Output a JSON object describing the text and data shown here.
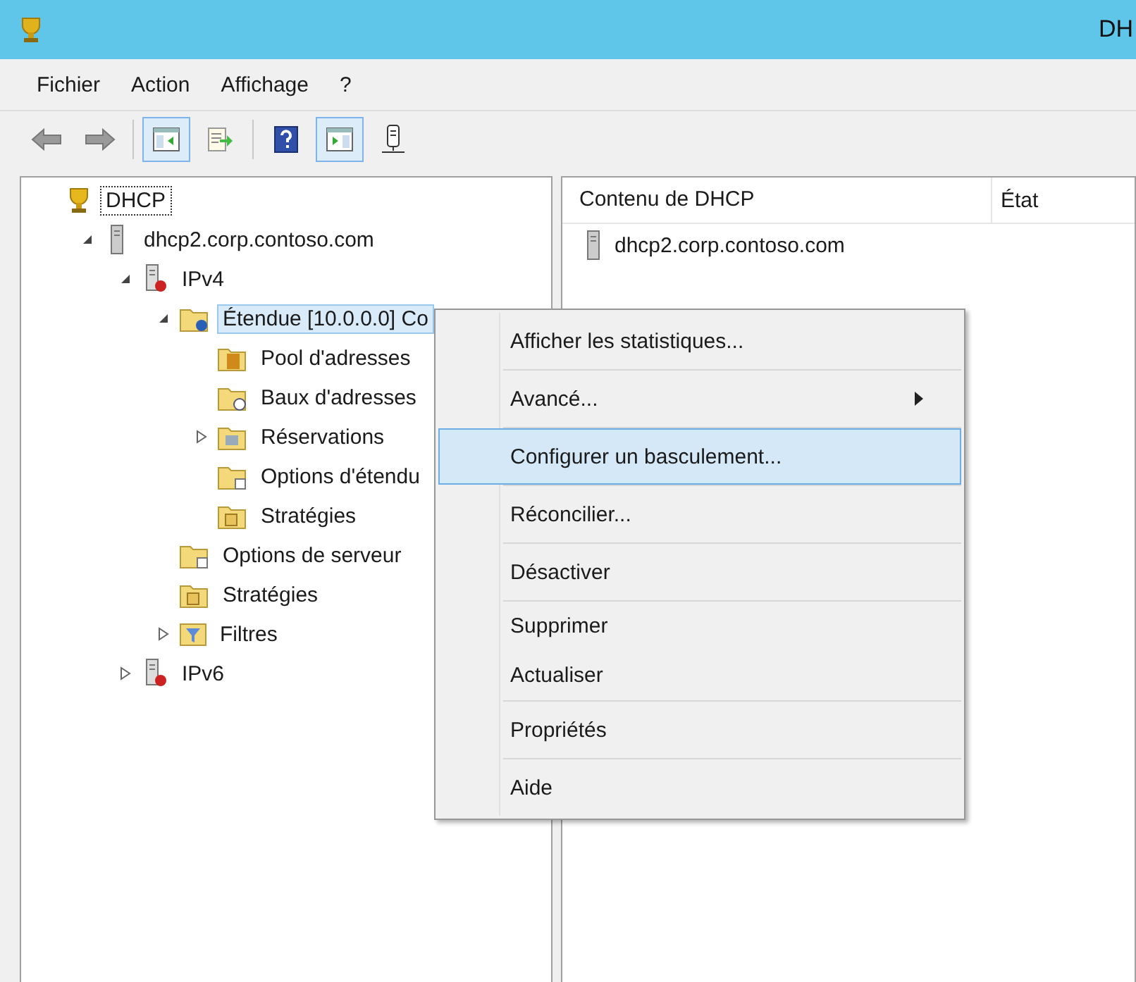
{
  "window": {
    "title": "DH"
  },
  "menu_bar": [
    "Fichier",
    "Action",
    "Affichage",
    "?"
  ],
  "toolbar": [
    {
      "kind": "back",
      "pressed": false
    },
    {
      "kind": "forward",
      "pressed": false
    },
    {
      "kind": "separator"
    },
    {
      "kind": "console-tree",
      "pressed": true
    },
    {
      "kind": "export",
      "pressed": false
    },
    {
      "kind": "separator"
    },
    {
      "kind": "help",
      "pressed": false
    },
    {
      "kind": "action-pane",
      "pressed": true
    },
    {
      "kind": "server",
      "pressed": false
    }
  ],
  "tree": [
    {
      "label": "DHCP",
      "kind": "trophy",
      "selected": false,
      "focused": true,
      "children": [
        {
          "label": "dhcp2.corp.contoso.com",
          "kind": "server",
          "expanded": true,
          "selected": false,
          "focused": false,
          "children": [
            {
              "label": "IPv4",
              "kind": "netserver",
              "expanded": true,
              "selected": false,
              "focused": false,
              "children": [
                {
                  "label": "Étendue [10.0.0.0] Co",
                  "kind": "scope",
                  "expanded": true,
                  "selected": true,
                  "focused": false,
                  "children": [
                    {
                      "label": "Pool d'adresses",
                      "kind": "pool",
                      "selected": false,
                      "focused": false
                    },
                    {
                      "label": "Baux d'adresses",
                      "kind": "lease",
                      "selected": false,
                      "focused": false
                    },
                    {
                      "label": "Réservations",
                      "kind": "grid",
                      "expanded": false,
                      "selected": false,
                      "focused": false
                    },
                    {
                      "label": "Options d'étendu",
                      "kind": "options",
                      "selected": false,
                      "focused": false
                    },
                    {
                      "label": "Stratégies",
                      "kind": "policy",
                      "selected": false,
                      "focused": false
                    }
                  ]
                },
                {
                  "label": "Options de serveur",
                  "kind": "options",
                  "selected": false,
                  "focused": false
                },
                {
                  "label": "Stratégies",
                  "kind": "policy",
                  "selected": false,
                  "focused": false
                },
                {
                  "label": "Filtres",
                  "kind": "filter",
                  "expanded": false,
                  "selected": false,
                  "focused": false
                }
              ]
            },
            {
              "label": "IPv6",
              "kind": "netserver",
              "expanded": false,
              "selected": false,
              "focused": false
            }
          ]
        }
      ]
    }
  ],
  "content": {
    "columns": [
      "Contenu de DHCP",
      "État"
    ],
    "rows": [
      {
        "name": "dhcp2.corp.contoso.com"
      }
    ]
  },
  "context_menu": {
    "groups": [
      [
        {
          "label": "Afficher les statistiques...",
          "selected": false,
          "submenu": false
        }
      ],
      [
        {
          "label": "Avancé...",
          "selected": false,
          "submenu": true
        }
      ],
      [
        {
          "label": "Configurer un basculement...",
          "selected": true,
          "submenu": false
        }
      ],
      [
        {
          "label": "Réconcilier...",
          "selected": false,
          "submenu": false
        }
      ],
      [
        {
          "label": "Désactiver",
          "selected": false,
          "submenu": false
        }
      ],
      [
        {
          "label": "Supprimer",
          "selected": false,
          "submenu": false
        },
        {
          "label": "Actualiser",
          "selected": false,
          "submenu": false
        }
      ],
      [
        {
          "label": "Propriétés",
          "selected": false,
          "submenu": false
        }
      ],
      [
        {
          "label": "Aide",
          "selected": false,
          "submenu": false
        }
      ]
    ]
  }
}
